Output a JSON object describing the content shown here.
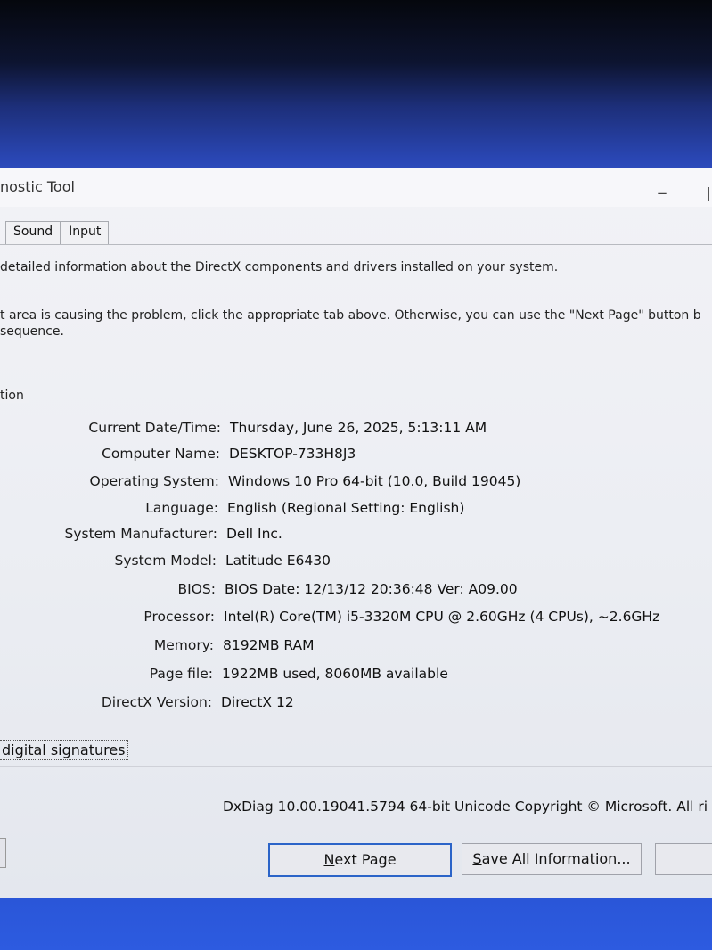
{
  "window": {
    "title": "nostic Tool",
    "minimize_glyph": "_"
  },
  "tabs": [
    {
      "label": "Sound"
    },
    {
      "label": "Input"
    }
  ],
  "intro": {
    "line1": "detailed information about the DirectX components and drivers installed on your system.",
    "line2": "t area is causing the problem, click the appropriate tab above.  Otherwise, you can use the \"Next Page\" button b",
    "line3": "sequence."
  },
  "group": {
    "label": "tion"
  },
  "system_info": [
    {
      "label": "Current Date/Time:",
      "value": "Thursday, June 26, 2025, 5:13:11 AM"
    },
    {
      "label": "Computer Name:",
      "value": "DESKTOP-733H8J3"
    },
    {
      "label": "Operating System:",
      "value": "Windows 10 Pro 64-bit (10.0, Build 19045)"
    },
    {
      "label": "Language:",
      "value": "English (Regional Setting: English)"
    },
    {
      "label": "System Manufacturer:",
      "value": "Dell Inc."
    },
    {
      "label": "System Model:",
      "value": "Latitude E6430"
    },
    {
      "label": "BIOS:",
      "value": "BIOS Date: 12/13/12 20:36:48 Ver: A09.00"
    },
    {
      "label": "Processor:",
      "value": "Intel(R) Core(TM) i5-3320M CPU @ 2.60GHz (4 CPUs), ~2.6GHz"
    },
    {
      "label": "Memory:",
      "value": "8192MB RAM"
    },
    {
      "label": "Page file:",
      "value": "1922MB used, 8060MB available"
    },
    {
      "label": "DirectX Version:",
      "value": "DirectX 12"
    }
  ],
  "check_label": "digital signatures",
  "version_text": "DxDiag 10.00.19041.5794 64-bit Unicode  Copyright © Microsoft. All ri",
  "buttons": {
    "next": "Next Page",
    "save": "Save All Information..."
  }
}
